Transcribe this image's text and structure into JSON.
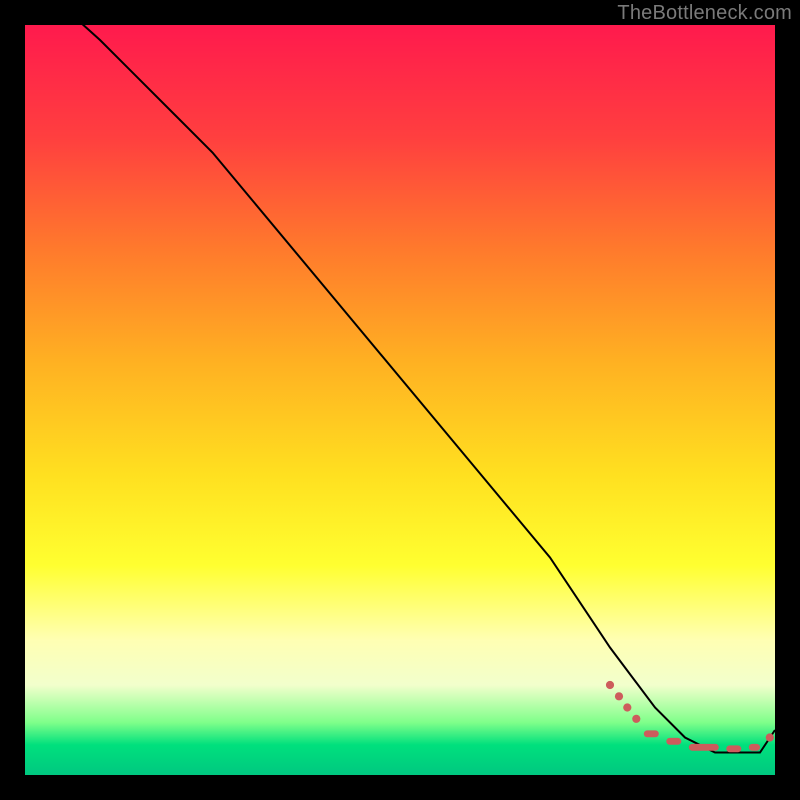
{
  "watermark": "TheBottleneck.com",
  "chart_data": {
    "type": "line",
    "title": "",
    "xlabel": "",
    "ylabel": "",
    "xlim": [
      0,
      100
    ],
    "ylim": [
      0,
      100
    ],
    "series": [
      {
        "name": "curve",
        "x": [
          0,
          10,
          20,
          25,
          30,
          40,
          50,
          60,
          70,
          78,
          84,
          88,
          92,
          95,
          98,
          100
        ],
        "y": [
          107,
          98,
          88,
          83,
          77,
          65,
          53,
          41,
          29,
          17,
          9,
          5,
          3,
          3,
          3,
          6
        ]
      }
    ],
    "markers": {
      "dashes_pct": [
        {
          "x0": 82.5,
          "x1": 84.5,
          "y": 5.5
        },
        {
          "x0": 85.5,
          "x1": 87.5,
          "y": 4.5
        },
        {
          "x0": 88.5,
          "x1": 92.5,
          "y": 3.7
        },
        {
          "x0": 93.5,
          "x1": 95.5,
          "y": 3.5
        },
        {
          "x0": 96.5,
          "x1": 98.0,
          "y": 3.7
        }
      ],
      "dash_thickness_pct": 0.9,
      "points_pct": [
        {
          "x": 78.0,
          "y": 12.0
        },
        {
          "x": 79.2,
          "y": 10.5
        },
        {
          "x": 80.3,
          "y": 9.0
        },
        {
          "x": 81.5,
          "y": 7.5
        },
        {
          "x": 99.3,
          "y": 5.0
        }
      ],
      "point_radius_pct": 0.55
    },
    "gradient_stops": [
      {
        "pos": 0.0,
        "color": "#ff1a4d"
      },
      {
        "pos": 0.15,
        "color": "#ff3f3f"
      },
      {
        "pos": 0.3,
        "color": "#ff7a2c"
      },
      {
        "pos": 0.45,
        "color": "#ffb122"
      },
      {
        "pos": 0.6,
        "color": "#ffe020"
      },
      {
        "pos": 0.72,
        "color": "#ffff30"
      },
      {
        "pos": 0.82,
        "color": "#ffffb3"
      },
      {
        "pos": 0.88,
        "color": "#f2ffcc"
      },
      {
        "pos": 0.93,
        "color": "#7fff8a"
      },
      {
        "pos": 0.96,
        "color": "#00e07d"
      },
      {
        "pos": 1.0,
        "color": "#00c880"
      }
    ]
  }
}
